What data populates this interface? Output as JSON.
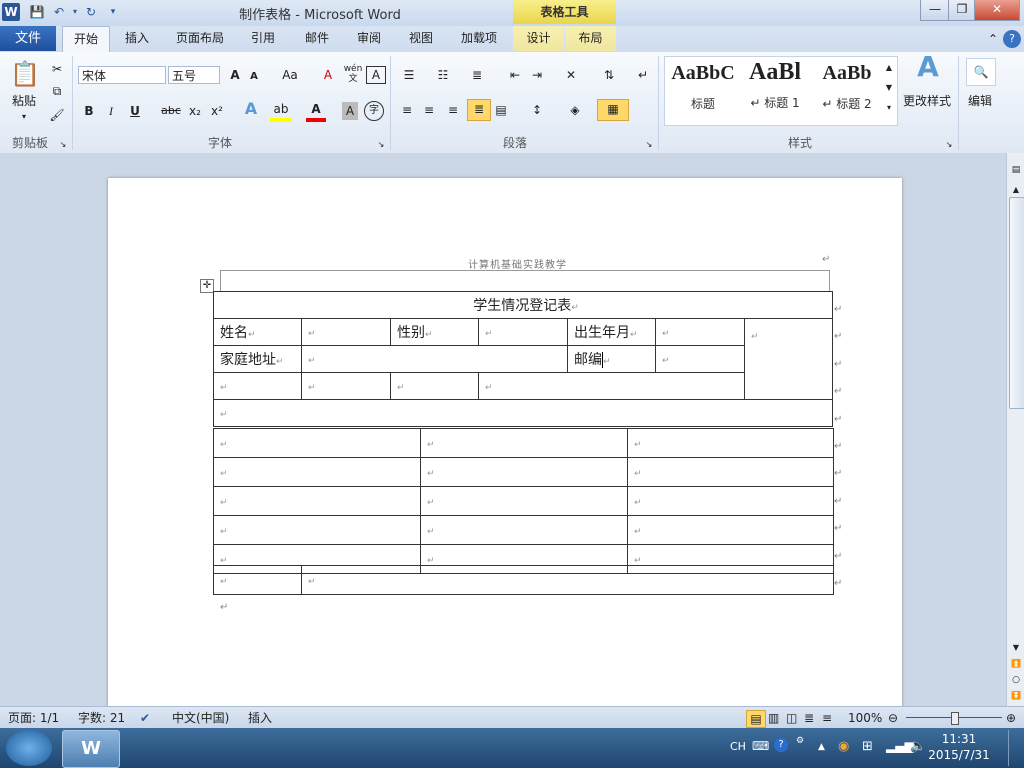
{
  "window": {
    "title": "制作表格 - Microsoft Word",
    "context_tab_header": "表格工具"
  },
  "tabs": {
    "file": "文件",
    "home": "开始",
    "insert": "插入",
    "layout": "页面布局",
    "references": "引用",
    "mailings": "邮件",
    "review": "审阅",
    "view": "视图",
    "addins": "加载项",
    "design": "设计",
    "table_layout": "布局"
  },
  "ribbon": {
    "clipboard": {
      "paste": "粘贴",
      "label": "剪贴板"
    },
    "font": {
      "name": "宋体",
      "size": "五号",
      "label": "字体",
      "bold": "B",
      "italic": "I",
      "underline": "U",
      "strike": "abc",
      "sub": "x₂",
      "sup": "x²",
      "grow": "A",
      "shrink": "A",
      "case": "Aa",
      "clear": "A",
      "char_border": "A",
      "effects": "A",
      "highlight": "ab",
      "color": "A",
      "shade": "A",
      "enclose": "字",
      "phonetic": "wén",
      "phonetic_base": "文"
    },
    "paragraph": {
      "label": "段落"
    },
    "styles": {
      "label": "样式",
      "items": [
        {
          "sample": "AaBbC",
          "name": "标题"
        },
        {
          "sample": "AaBl",
          "name": "↵ 标题 1"
        },
        {
          "sample": "AaBb",
          "name": "↵ 标题 2"
        }
      ],
      "change": "更改样式"
    },
    "edit": {
      "label": "编辑"
    }
  },
  "document": {
    "header": "计算机基础实践教学",
    "table": {
      "title": "学生情况登记表",
      "name": "姓名",
      "gender": "性别",
      "birth": "出生年月",
      "address": "家庭地址",
      "postcode": "邮编"
    },
    "mark": "↵"
  },
  "status": {
    "page": "页面: 1/1",
    "words": "字数: 21",
    "language": "中文(中国)",
    "mode": "插入",
    "zoom": "100%"
  },
  "taskbar": {
    "time": "11:31",
    "date": "2015/7/31",
    "ime": "CH"
  }
}
